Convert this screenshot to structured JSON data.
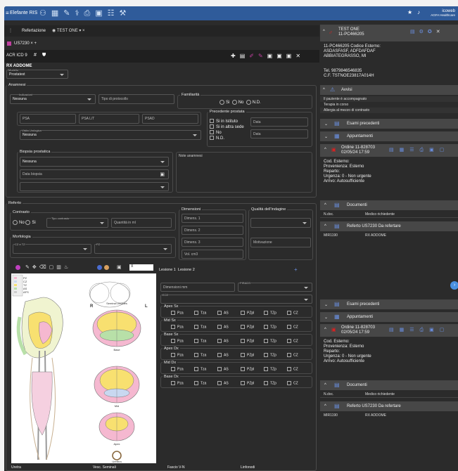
{
  "app": {
    "title": "Elefante RIS",
    "user_name": "icoweb",
    "user_org": "AGFA Healthcare"
  },
  "secbar": {
    "label": "Refertazione",
    "tab": "TEST ONE"
  },
  "tabbar": {
    "tab": "US7230"
  },
  "toolbar": {
    "code": "ACR ICD 9"
  },
  "exam": {
    "title": "RX ADDOME",
    "modello_label": "Modello",
    "modello_value": "Prostatest"
  },
  "anamnesi": {
    "legend": "Anamnesi",
    "indicazioni_label": "Indicazioni",
    "indicazioni_value": "Nessuna",
    "tipo_protocollo": "Tipo di protocollo",
    "familiarita_legend": "Familiarità",
    "fam_options": [
      "Si",
      "No",
      "N.D."
    ],
    "psa": "PSA",
    "psa_lt": "PSA L/T",
    "psad": "PSAD",
    "precedente_legend": "Precedente prostata",
    "prec_options": [
      "Si in Istituto",
      "Si in altra sede",
      "No",
      "N.D."
    ],
    "data1": "Data",
    "data2": "Data",
    "visita_label": "Visita Urologica",
    "visita_value": "Nessuna",
    "biopsia_legend": "Biopsia prostatica",
    "biopsia_value": "Nessuna",
    "data_biopsia": "Data biopsia",
    "note_label": "Note anamnesi"
  },
  "referto": {
    "legend": "Referto",
    "contrasto_legend": "Contrasto",
    "contrasto_options": [
      "No",
      "Si"
    ],
    "tipo_contrasto": "Tipo contrasto",
    "quantita": "Quantità in ml",
    "dimensioni_legend": "Dimensioni",
    "dim1": "Dimens. 1",
    "dim2": "Dimens. 2",
    "dim3": "Dimens. 3",
    "vol": "Vol. cm3",
    "qualita_legend": "Qualità dell'indagine",
    "motivazione": "Motivazione",
    "morfologia_legend": "Morfologia",
    "cz_tz": "CZ e TZ",
    "pz": "PZ"
  },
  "drawing": {
    "size_value": "X",
    "legend_items": [
      "PZ",
      "CZ",
      "TZ",
      "AS",
      "AFS"
    ],
    "seminal": "Seminal vesicles",
    "R": "R",
    "L": "L",
    "base": "Base",
    "mid": "Mid",
    "apex": "Apex",
    "urethra": "Urethra"
  },
  "lesioni": {
    "tab1": "Lesione 1",
    "tab2": "Lesione 2",
    "dimensioni": "Dimensioni mm",
    "pirads": "PIRADS",
    "ece": "ECE",
    "checks": [
      "Pza",
      "Tza",
      "AS",
      "PZpl",
      "TZp",
      "CZ"
    ],
    "zones": [
      "Apex Sx",
      "Mid Sx",
      "Base Sx",
      "Apex Dx",
      "Mid Dx",
      "Base Dx"
    ]
  },
  "bottom": {
    "items": [
      "Uretra",
      "Vesc. Seminali",
      "Fascio V-N",
      "Linfonodi"
    ]
  },
  "patient": {
    "name": "TEST ONE",
    "id": "11-PC466205",
    "lines": [
      "11-PC466205 Codice Esterno:",
      "ASDASFASF, ADFDAFDAF",
      "ABBIATEGRASSO, MI",
      "Tel. 9879846546835",
      "C.F. TSTNOE23817A014H"
    ]
  },
  "avvisi": {
    "title": "Avvisi",
    "lines": [
      "Il paziente è accompagnato",
      "Terapia in corso",
      "Allergia al mezzo di contrasto"
    ]
  },
  "sections": {
    "esami": "Esami precedenti",
    "appuntamenti": "Appuntamenti"
  },
  "order": {
    "title": "Ordine 11-828703",
    "date": "02/05/24 17:59",
    "lines": [
      "Cod. Esterno:",
      "Provenienza: Esterno",
      "Reparto:",
      "Urgenza: 0 - Non urgente",
      "Arrivo: Autosufficiente"
    ]
  },
  "documenti": {
    "title": "Documenti",
    "col1": "N.doc.",
    "col2": "Medico richiedente"
  },
  "refertolist": {
    "title": "Referto US7230 Da refertare",
    "code": "MIR1190",
    "exam": "RX ADDOME"
  },
  "colors": {
    "accent": "#2f5b9a",
    "icon": "#6a8fe0",
    "alert": "#e02020"
  }
}
